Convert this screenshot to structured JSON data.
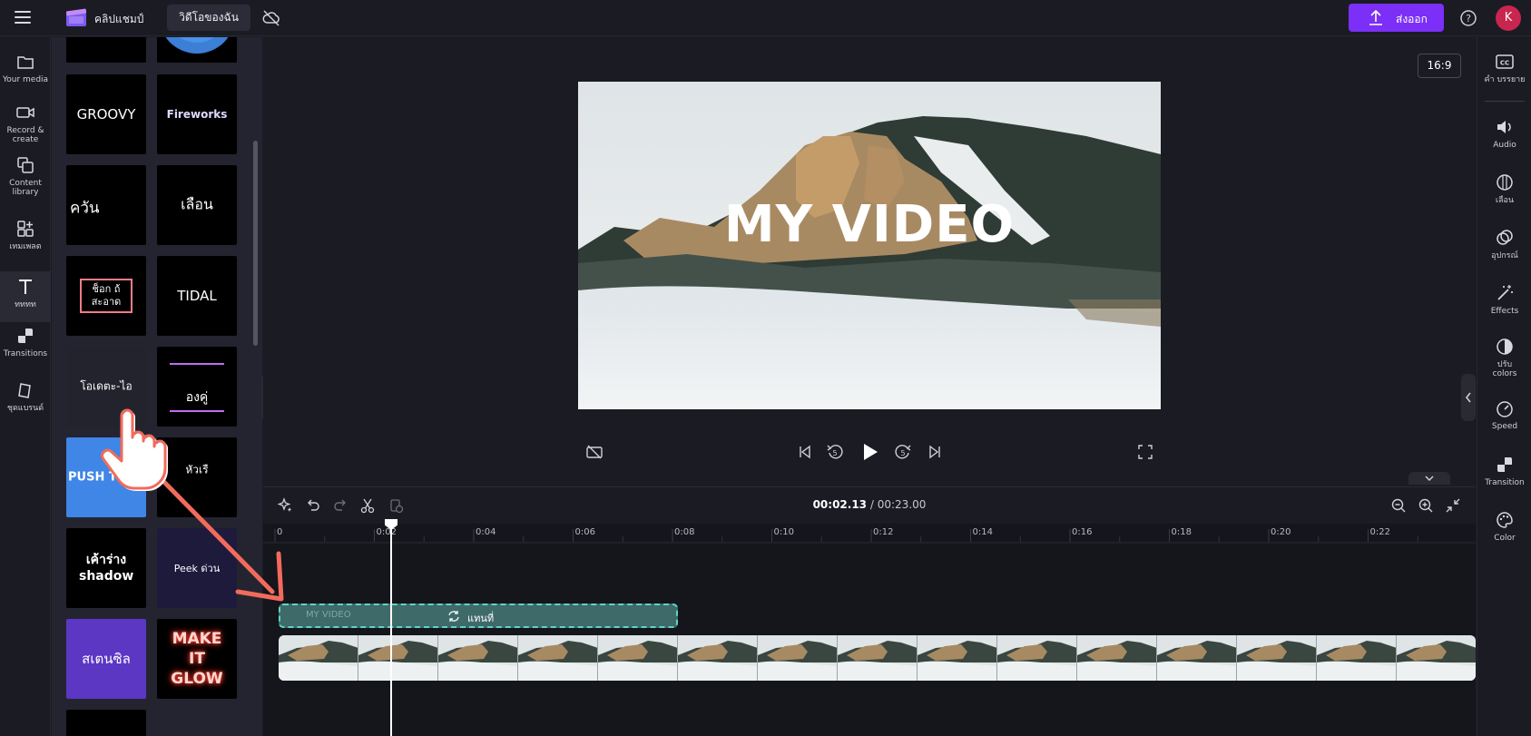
{
  "header": {
    "app_title": "คลิปแชมป์",
    "project_tab": "วิดีโอของฉัน",
    "export_label": "ส่งออก",
    "avatar_initial": "K"
  },
  "left_rail": {
    "items": [
      {
        "label": "Your media",
        "icon": "folder-icon"
      },
      {
        "label": "Record & create",
        "icon": "camera-icon"
      },
      {
        "label": "Content library",
        "icon": "library-icon"
      },
      {
        "label": "เทมเพลต",
        "icon": "templates-icon"
      },
      {
        "label": "ทททท",
        "icon": "text-icon"
      },
      {
        "label": "Transitions",
        "icon": "transitions-icon"
      },
      {
        "label": "ชุดแบรนด์",
        "icon": "brand-kit-icon"
      }
    ]
  },
  "templates": {
    "tiles": [
      {
        "label": "GROOVY"
      },
      {
        "label": "Fireworks"
      },
      {
        "label": "ควัน"
      },
      {
        "label": "เลือน"
      },
      {
        "label": "ช็อก ถ้สะอาด"
      },
      {
        "label": "TIDAL"
      },
      {
        "label": "โอเดตะ-ไอ"
      },
      {
        "label": "องคู่"
      },
      {
        "label": "PUSH THRU"
      },
      {
        "label": "หัวเรื"
      },
      {
        "label": "เค้าร่าง shadow"
      },
      {
        "label": "Peek ด่วน"
      },
      {
        "label": "สเตนซิล"
      },
      {
        "label": "MAKE IT GLOW"
      }
    ]
  },
  "preview": {
    "aspect_ratio": "16:9",
    "overlay_text": "MY VIDEO"
  },
  "timeline": {
    "current_time": "00:02.13",
    "total_time": "/ 00:23.00",
    "ticks": [
      "0",
      "0:02",
      "0:04",
      "0:06",
      "0:08",
      "0:10",
      "0:12",
      "0:14",
      "0:16",
      "0:18",
      "0:20",
      "0:22"
    ],
    "text_clip_label": "MY VIDEO",
    "replace_label": "แทนที่"
  },
  "right_rail": {
    "items": [
      {
        "label": "คำ บรรยาย",
        "icon": "captions-icon"
      },
      {
        "label": "Audio",
        "icon": "audio-icon"
      },
      {
        "label": "เลือน",
        "icon": "fade-icon"
      },
      {
        "label": "อุปกรณ์",
        "icon": "filters-icon"
      },
      {
        "label": "Effects",
        "icon": "effects-icon"
      },
      {
        "label": "ปรับ colors",
        "icon": "adjust-colors-icon"
      },
      {
        "label": "Speed",
        "icon": "speed-icon"
      },
      {
        "label": "Transition",
        "icon": "transition-icon"
      },
      {
        "label": "Color",
        "icon": "color-palette-icon"
      }
    ]
  },
  "colors": {
    "accent": "#7b2ff7",
    "avatar": "#c8264f",
    "clip_border": "#5dd6c0",
    "annotation_arrow": "#f26b5b"
  }
}
